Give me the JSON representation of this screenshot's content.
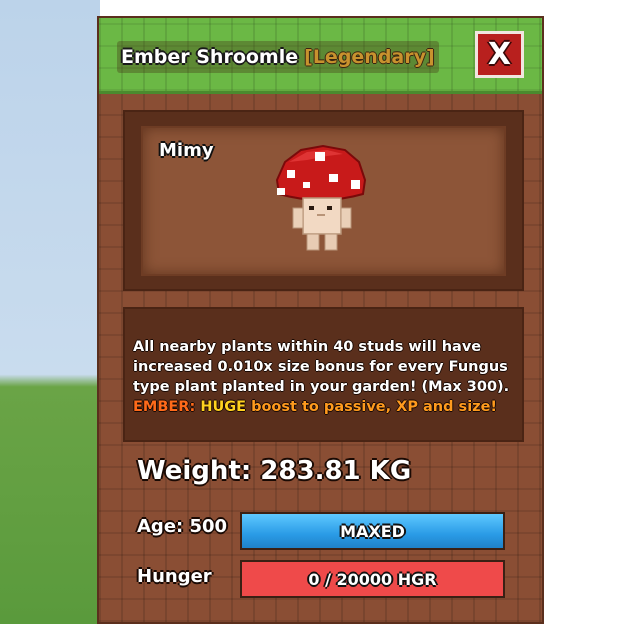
{
  "window": {
    "title_name": "Ember Shroomle",
    "title_rarity": "[Legendary]",
    "close_label": "X"
  },
  "pet": {
    "nickname": "Mimy",
    "icon": "mushroom-pet-icon"
  },
  "description": {
    "passive": "All nearby plants within 40 studs will have increased 0.010x size bonus for every Fungus type plant planted in your garden! (Max 300).",
    "mutation_name": "EMBER:",
    "mutation_highlight": " HUGE",
    "mutation_rest": " boost to passive, XP and size!"
  },
  "stats": {
    "weight_text": "Weight: 283.81 KG",
    "age_label": "Age: 500",
    "age_bar_text": "MAXED",
    "age_fill_fraction": 1.0,
    "hunger_label": "Hunger",
    "hunger_bar_text": "0 / 20000 HGR",
    "hunger_fill_fraction": 0.0
  },
  "colors": {
    "title_green": "#6bb845",
    "panel_brown": "#8a4e34",
    "close_red": "#b8201e",
    "age_blue": "#2a9be6",
    "hunger_red": "#ef4a4a",
    "rarity_gold": "#c8922e"
  }
}
